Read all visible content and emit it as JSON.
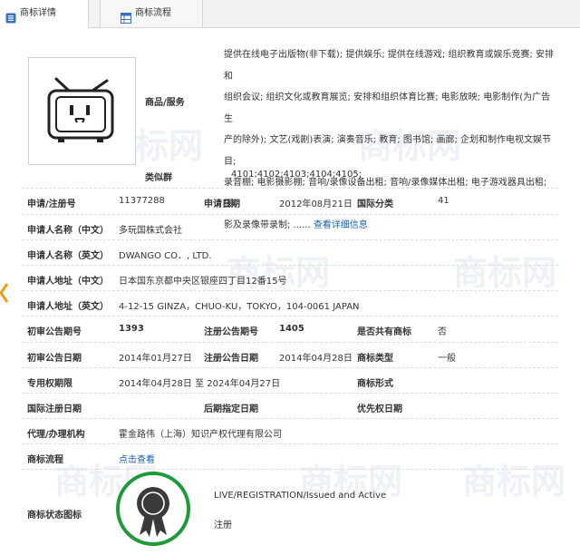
{
  "tabs": {
    "detail": "商标详情",
    "process": "商标流程"
  },
  "watermark": "商标网",
  "goods": {
    "label": "商品/服务",
    "lines": [
      "提供在线电子出版物(非下载); 提供娱乐; 提供在线游戏; 组织教育或娱乐竞赛; 安排和",
      "组织会议; 组织文化或教育展览; 安排和组织体育比赛; 电影放映; 电影制作(为广告生",
      "产的除外); 文艺(戏剧)表演; 演奏音乐; 教育; 图书馆; 画廊; 企划和制作电视文娱节目;",
      "录音棚; 电影摄影棚; 音响/录像设备出租; 音响/录像媒体出租; 电子游戏器具出租; 摄",
      "影及录像带录制; ......"
    ],
    "more_link": "查看详细信息"
  },
  "similar_group": {
    "label": "类似群",
    "value": "4101;4102;4103;4104;4105;"
  },
  "fields": {
    "reg_no_label": "申请/注册号",
    "reg_no": "11377288",
    "app_date_label": "申请日期",
    "app_date": "2012年08月21日",
    "intl_class_label": "国际分类",
    "intl_class": "41",
    "applicant_cn_label": "申请人名称（中文）",
    "applicant_cn": "多玩国株式会社",
    "applicant_en_label": "申请人名称（英文）",
    "applicant_en": "DWANGO CO．, LTD.",
    "address_cn_label": "申请人地址（中文）",
    "address_cn": "日本国东京都中央区银座四丁目12番15号",
    "address_en_label": "申请人地址（英文）",
    "address_en": "4-12-15 GINZA，CHUO-KU，TOKYO，104-0061 JAPAN",
    "prelim_no_label": "初审公告期号",
    "prelim_no": "1393",
    "reg_pub_no_label": "注册公告期号",
    "reg_pub_no": "1405",
    "shared_label": "是否共有商标",
    "shared": "否",
    "prelim_date_label": "初审公告日期",
    "prelim_date": "2014年01月27日",
    "reg_pub_date_label": "注册公告日期",
    "reg_pub_date": "2014年04月28日",
    "mark_type_label": "商标类型",
    "mark_type": "一般",
    "exclusive_label": "专用权期限",
    "exclusive": "2014年04月28日 至 2024年04月27日",
    "mark_form_label": "商标形式",
    "intl_reg_date_label": "国际注册日期",
    "later_date_label": "后期指定日期",
    "priority_label": "优先权日期",
    "agency_label": "代理/办理机构",
    "agency": "霍金路伟（上海）知识产权代理有限公司",
    "process_label": "商标流程",
    "process_link": "点击查看",
    "status_icon_label": "商标状态图标",
    "status_text": "LIVE/REGISTRATION/Issued and Active",
    "status_cn": "注册"
  },
  "colors": {
    "link": "#1a5fa8",
    "badge_ring": "#1e9a3a",
    "accent_arrow": "#f39c12"
  }
}
